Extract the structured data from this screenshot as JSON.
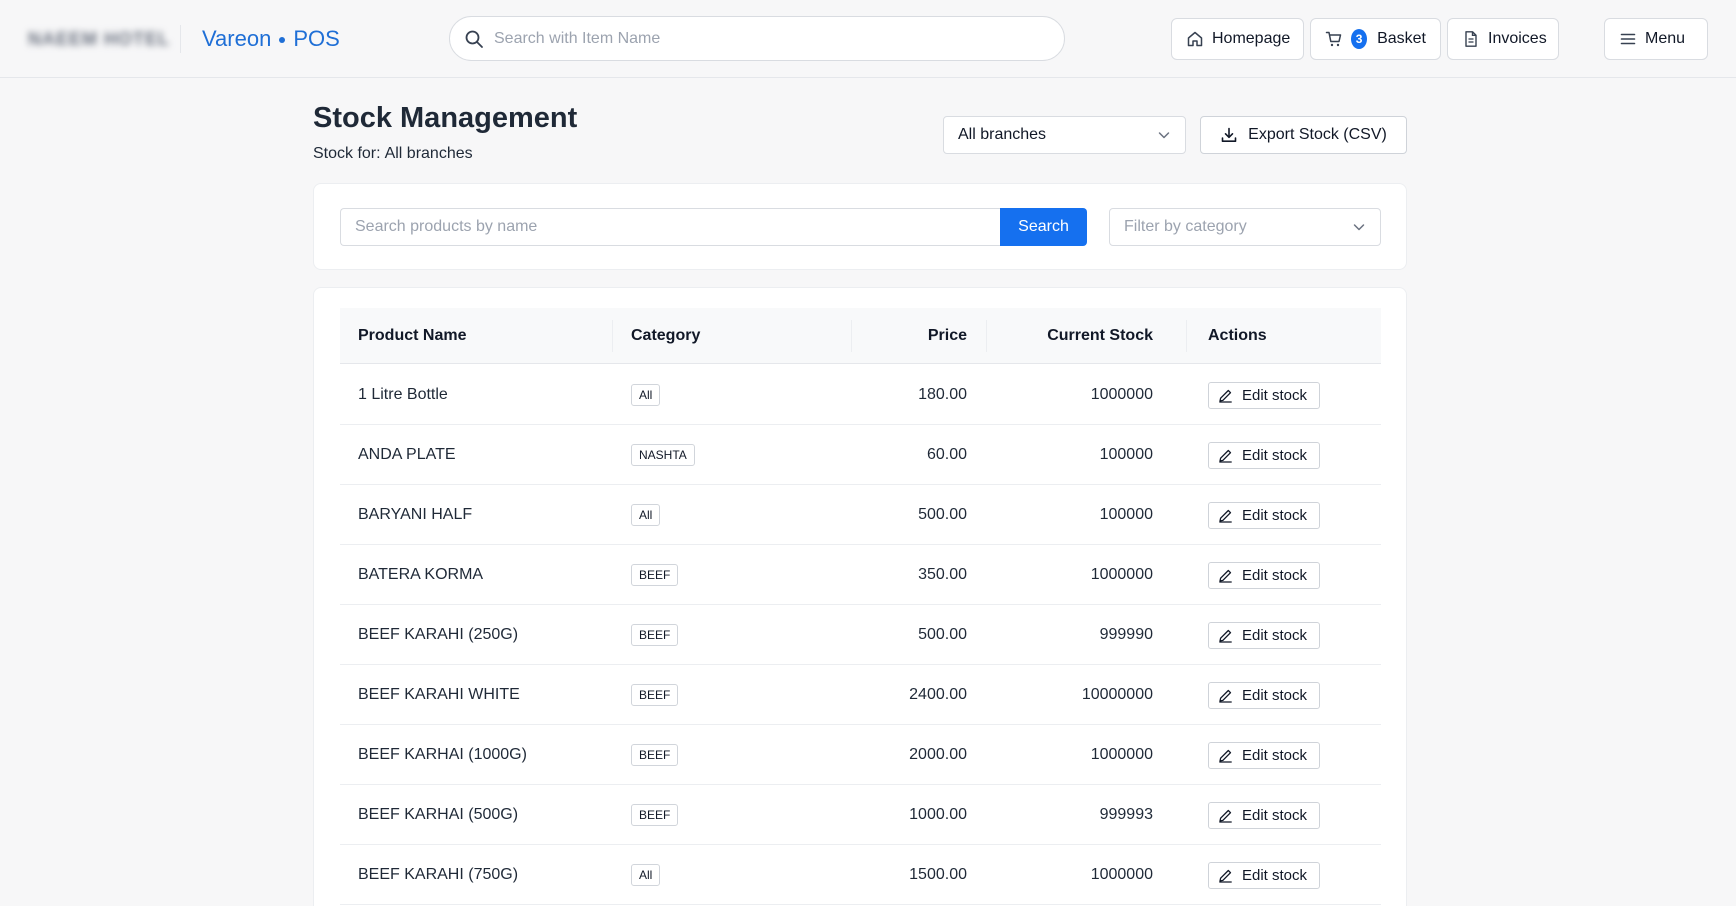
{
  "header": {
    "store_name": "NAEEM HOTEL",
    "brand_left": "Vareon",
    "brand_right": "POS",
    "search_placeholder": "Search with Item Name",
    "nav": {
      "homepage": "Homepage",
      "basket": "Basket",
      "basket_count": "3",
      "invoices": "Invoices",
      "menu": "Menu"
    }
  },
  "page": {
    "title": "Stock Management",
    "subtitle_prefix": "Stock for:",
    "subtitle_value": "All branches",
    "branch_select": "All branches",
    "export_label": "Export Stock (CSV)"
  },
  "filters": {
    "search_placeholder": "Search products by name",
    "search_button": "Search",
    "category_placeholder": "Filter by category"
  },
  "table": {
    "columns": [
      "Product Name",
      "Category",
      "Price",
      "Current Stock",
      "Actions"
    ],
    "action_label": "Edit stock",
    "rows": [
      {
        "name": "1 Litre Bottle",
        "category": "All",
        "price": "180.00",
        "stock": "1000000"
      },
      {
        "name": "ANDA PLATE",
        "category": "NASHTA",
        "price": "60.00",
        "stock": "100000"
      },
      {
        "name": "BARYANI HALF",
        "category": "All",
        "price": "500.00",
        "stock": "100000"
      },
      {
        "name": "BATERA KORMA",
        "category": "BEEF",
        "price": "350.00",
        "stock": "1000000"
      },
      {
        "name": "BEEF KARAHI (250G)",
        "category": "BEEF",
        "price": "500.00",
        "stock": "999990"
      },
      {
        "name": "BEEF KARAHI WHITE",
        "category": "BEEF",
        "price": "2400.00",
        "stock": "10000000"
      },
      {
        "name": "BEEF KARHAI (1000G)",
        "category": "BEEF",
        "price": "2000.00",
        "stock": "1000000"
      },
      {
        "name": "BEEF KARHAI (500G)",
        "category": "BEEF",
        "price": "1000.00",
        "stock": "999993"
      },
      {
        "name": "BEEF KARAHI (750G)",
        "category": "All",
        "price": "1500.00",
        "stock": "1000000"
      }
    ]
  },
  "colors": {
    "accent": "#1570ef",
    "brand": "#1f6fd6",
    "background": "#f7f7f8"
  }
}
